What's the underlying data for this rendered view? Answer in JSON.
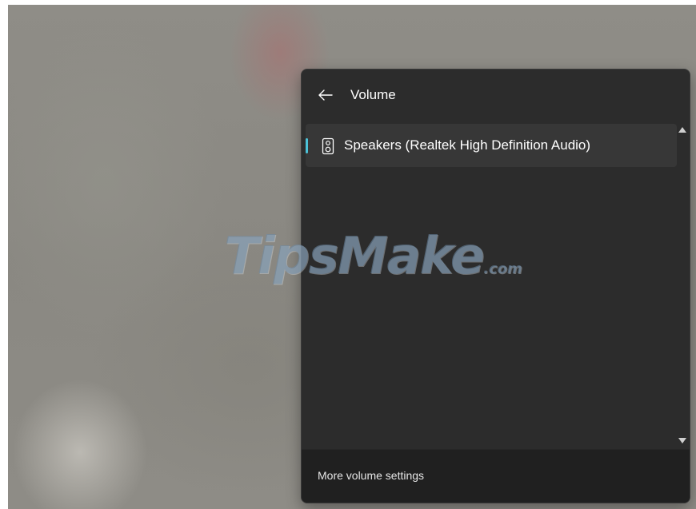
{
  "panel": {
    "title": "Volume",
    "back_icon": "arrow-left-icon"
  },
  "devices": [
    {
      "label": "Speakers (Realtek High Definition Audio)",
      "icon": "speaker-icon",
      "selected": true
    }
  ],
  "footer": {
    "link_label": "More volume settings"
  },
  "watermark": {
    "text": "TipsMake",
    "suffix": ".com"
  },
  "colors": {
    "panel_bg": "#2c2c2c",
    "footer_bg": "#202020",
    "item_bg": "#373737",
    "accent": "#4cc2d8"
  }
}
